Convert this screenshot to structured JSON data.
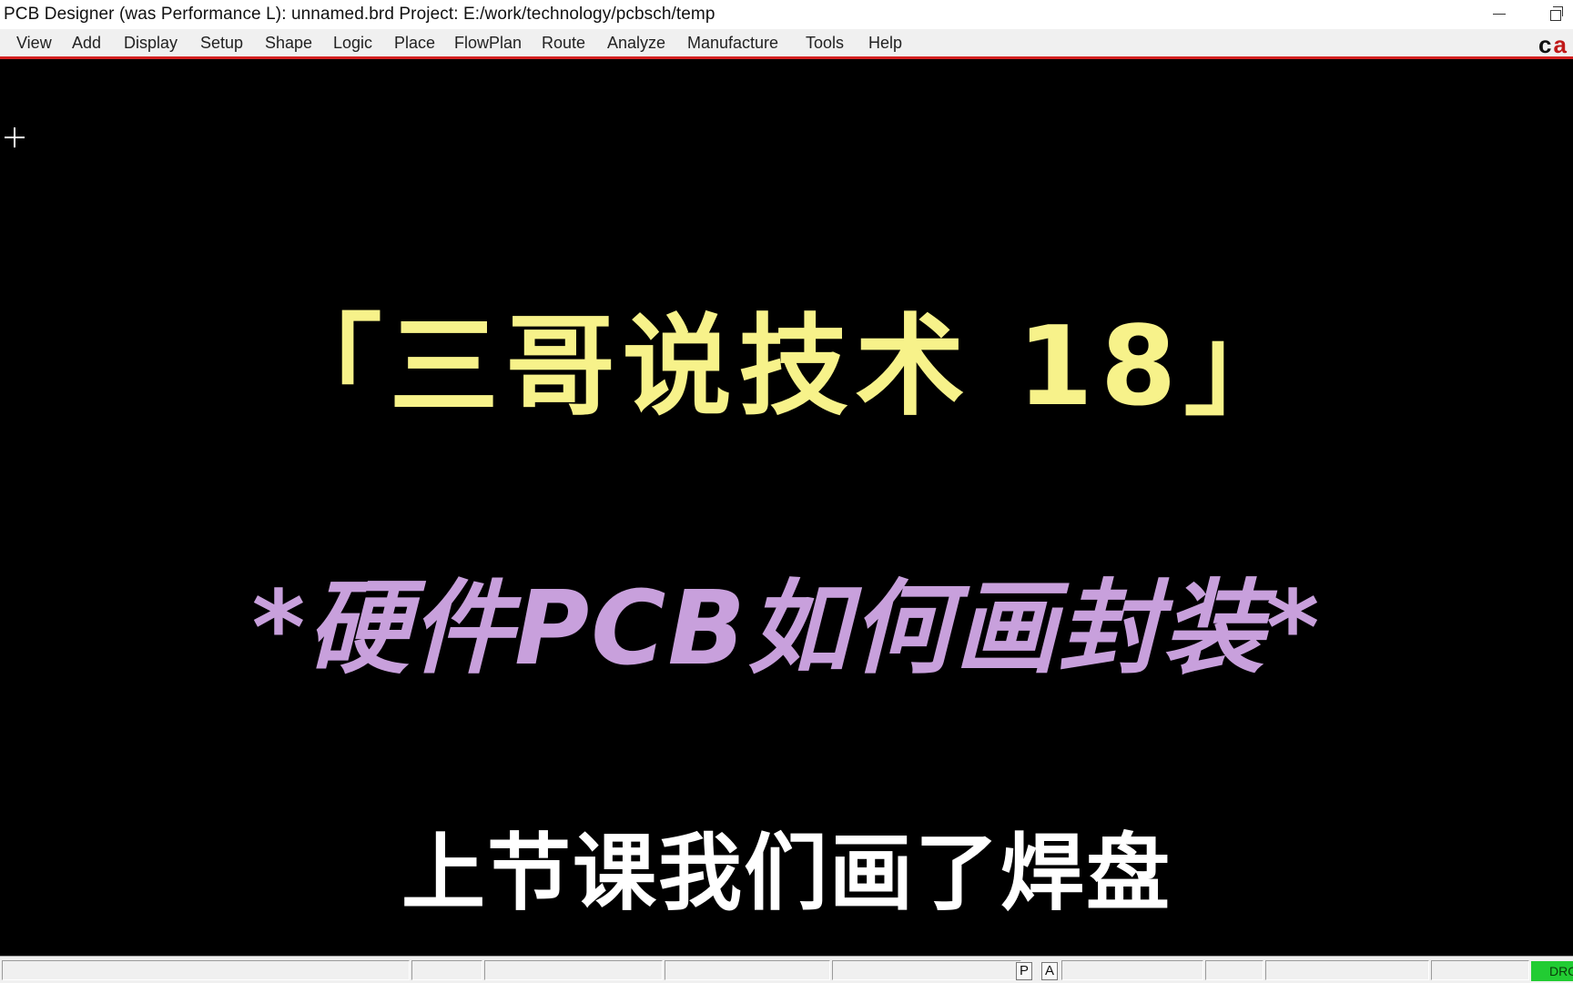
{
  "window": {
    "title": "PCB Designer (was Performance L): unnamed.brd  Project: E:/work/technology/pcbsch/temp",
    "minimize_glyph": "—",
    "restore_icon": "restore-icon"
  },
  "menubar": {
    "items": [
      {
        "label": "View"
      },
      {
        "label": "Add"
      },
      {
        "label": "Display"
      },
      {
        "label": "Setup"
      },
      {
        "label": "Shape"
      },
      {
        "label": "Logic"
      },
      {
        "label": "Place"
      },
      {
        "label": "FlowPlan"
      },
      {
        "label": "Route"
      },
      {
        "label": "Analyze"
      },
      {
        "label": "Manufacture"
      },
      {
        "label": "Tools"
      },
      {
        "label": "Help"
      }
    ],
    "brand_text_a": "c",
    "brand_text_b": "a",
    "accent_color": "#d42020"
  },
  "canvas": {
    "background": "#000000",
    "cursor_icon": "crosshair-icon",
    "captions": {
      "line1": "「三哥说技术 18」",
      "line2": "*硬件PCB如何画封装*",
      "line3": "上节课我们画了焊盘"
    },
    "caption_colors": {
      "line1": "#f7f28a",
      "line2": "#c8a0dc",
      "line3": "#ffffff"
    }
  },
  "statusbar": {
    "btn_p": "P",
    "btn_a": "A",
    "drc_label": "DRC",
    "drc_color": "#22cc33"
  }
}
